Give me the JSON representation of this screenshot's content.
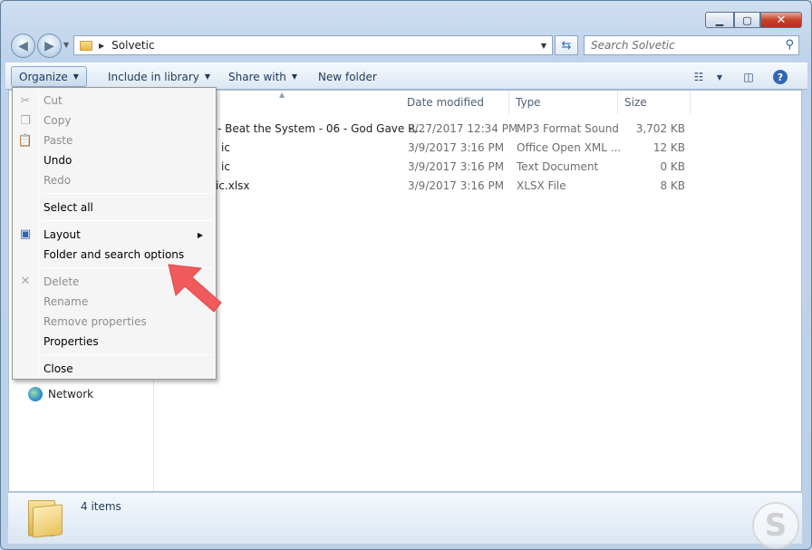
{
  "address": {
    "location": "Solvetic"
  },
  "search": {
    "placeholder": "Search Solvetic"
  },
  "toolbar": {
    "organize": "Organize",
    "include_in_library": "Include in library",
    "share_with": "Share with",
    "new_folder": "New folder"
  },
  "columns": {
    "date_modified": "Date modified",
    "type": "Type",
    "size": "Size"
  },
  "files": [
    {
      "name": "- Beat the System - 06 - God Gave R...",
      "date": "2/27/2017 12:34 PM",
      "type": "MP3 Format Sound",
      "size": "3,702 KB"
    },
    {
      "name": "ic",
      "date": "3/9/2017 3:16 PM",
      "type": "Office Open XML ...",
      "size": "12 KB"
    },
    {
      "name": "ic",
      "date": "3/9/2017 3:16 PM",
      "type": "Text Document",
      "size": "0 KB"
    },
    {
      "name": "ic.xlsx",
      "date": "3/9/2017 3:16 PM",
      "type": "XLSX File",
      "size": "8 KB"
    }
  ],
  "nav": {
    "network": "Network"
  },
  "menu": {
    "cut": "Cut",
    "copy": "Copy",
    "paste": "Paste",
    "undo": "Undo",
    "redo": "Redo",
    "select_all": "Select all",
    "layout": "Layout",
    "folder_options": "Folder and search options",
    "delete": "Delete",
    "rename": "Rename",
    "remove_properties": "Remove properties",
    "properties": "Properties",
    "close": "Close"
  },
  "status": {
    "items": "4 items"
  },
  "colors": {
    "arrow": "#f05a5a",
    "accent": "#1e395b"
  }
}
